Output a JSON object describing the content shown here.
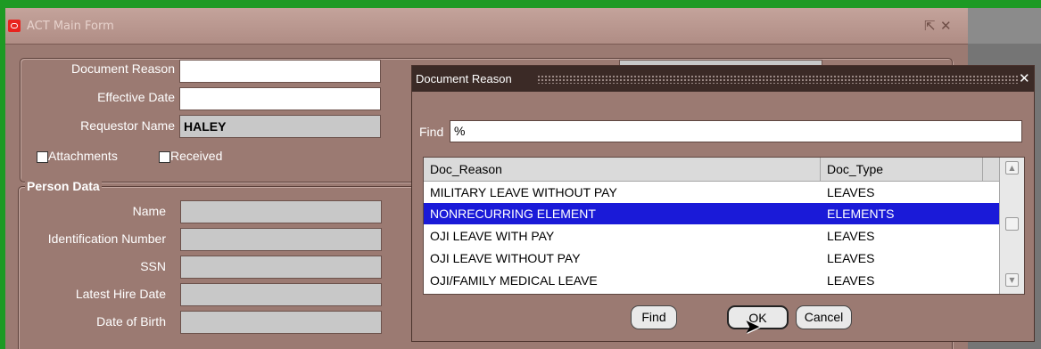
{
  "window": {
    "title": "ACT Main Form",
    "controls": [
      "restore-icon",
      "close-icon"
    ]
  },
  "form": {
    "document_reason": {
      "label": "Document Reason",
      "value": ""
    },
    "effective_date": {
      "label": "Effective Date",
      "value": ""
    },
    "requestor_name": {
      "label": "Requestor Name",
      "value": "HALEY"
    },
    "attachments": {
      "label": "Attachments",
      "checked": false
    },
    "received": {
      "label": "Received",
      "checked": false
    }
  },
  "person_data": {
    "title": "Person Data",
    "fields": [
      {
        "label": "Name",
        "value": ""
      },
      {
        "label": "Identification Number",
        "value": ""
      },
      {
        "label": "SSN",
        "value": ""
      },
      {
        "label": "Latest Hire Date",
        "value": ""
      },
      {
        "label": "Date of Birth",
        "value": ""
      }
    ]
  },
  "dialog": {
    "title": "Document Reason",
    "find_label": "Find",
    "find_value": "%",
    "columns": [
      "Doc_Reason",
      "Doc_Type"
    ],
    "rows": [
      {
        "reason": "MILITARY LEAVE WITHOUT PAY",
        "type": "LEAVES",
        "selected": false
      },
      {
        "reason": "NONRECURRING ELEMENT",
        "type": "ELEMENTS",
        "selected": true
      },
      {
        "reason": "OJI LEAVE WITH PAY",
        "type": "LEAVES",
        "selected": false
      },
      {
        "reason": "OJI LEAVE WITHOUT PAY",
        "type": "LEAVES",
        "selected": false
      },
      {
        "reason": "OJI/FAMILY MEDICAL LEAVE",
        "type": "LEAVES",
        "selected": false
      }
    ],
    "buttons": {
      "find": "Find",
      "ok": "OK",
      "cancel": "Cancel"
    }
  },
  "colors": {
    "desktop": "#1d9a24",
    "form_bg": "#9b7a72",
    "selection": "#1a1ad8",
    "dialog_title": "#3b2a26"
  }
}
